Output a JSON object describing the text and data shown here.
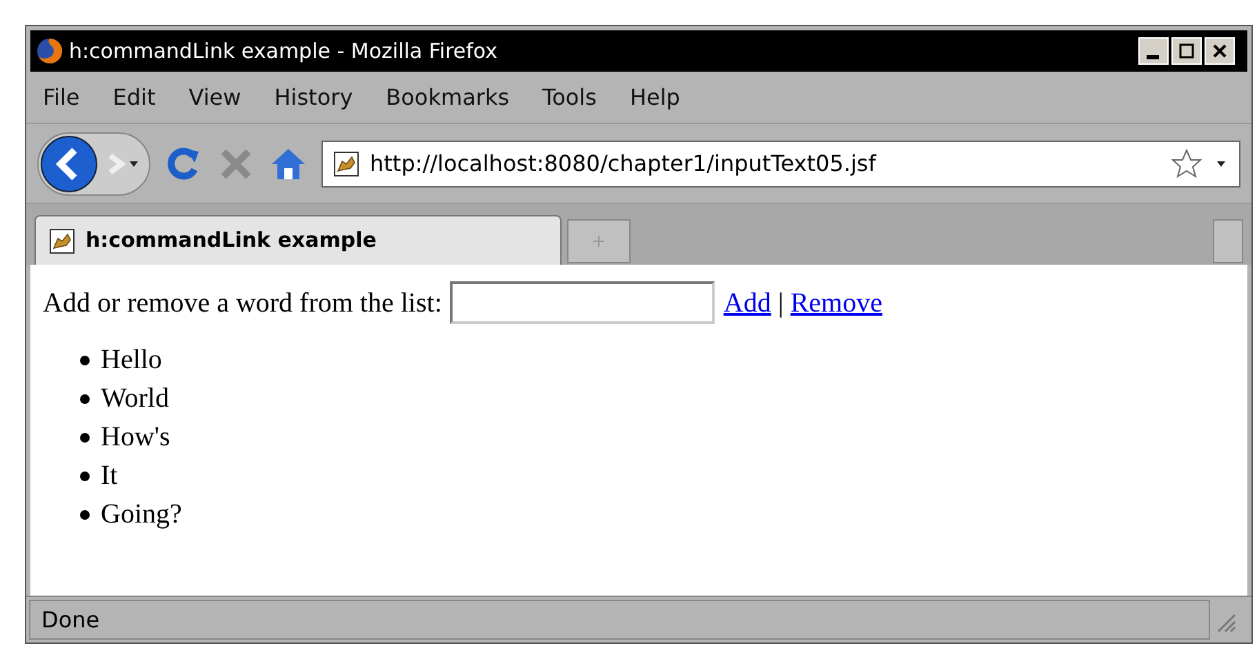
{
  "window": {
    "title": "h:commandLink example - Mozilla Firefox"
  },
  "menu": [
    "File",
    "Edit",
    "View",
    "History",
    "Bookmarks",
    "Tools",
    "Help"
  ],
  "address_bar": {
    "value": "http://localhost:8080/chapter1/inputText05.jsf"
  },
  "tabs": [
    {
      "label": "h:commandLink example",
      "selected": true
    }
  ],
  "page": {
    "prompt": "Add or remove a word from the list:",
    "links": [
      "Add",
      "Remove"
    ],
    "separator": "|",
    "words": [
      "Hello",
      "World",
      "How's",
      "It",
      "Going?"
    ]
  },
  "status_bar": "Done"
}
